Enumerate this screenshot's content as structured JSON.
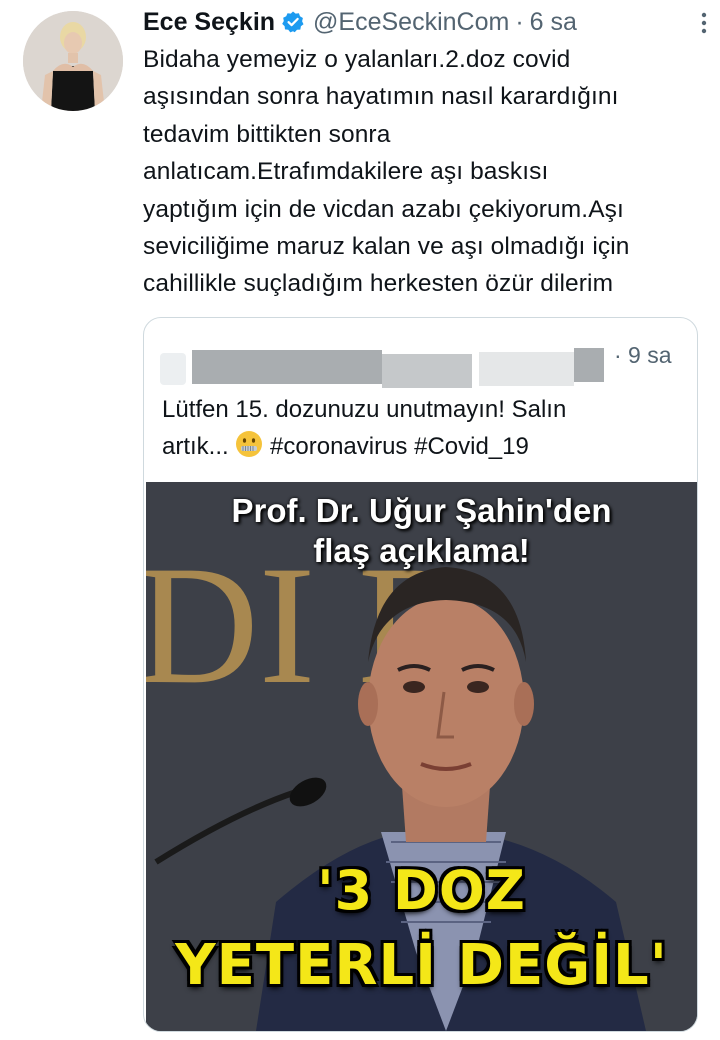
{
  "tweet": {
    "name": "Ece Seçkin",
    "handle": "@EceSeckinCom",
    "separator": "·",
    "time": "6 sa",
    "text": "Bidaha yemeyiz o yalanları.2.doz covid\naşısından sonra hayatımın nasıl karardığını\ntedavim bittikten sonra\nanlatıcam.Etrafımdakilere aşı baskısı\nyaptığım için de vicdan azabı çekiyorum.Aşı\nseviciliğime maruz kalan ve aşı olmadığı için\ncahillikle suçladığım herkesten özür dilerim",
    "icons": {
      "verified": "verified-badge-icon",
      "more": "more-options-icon",
      "avatar": "profile-avatar"
    },
    "colors": {
      "verified": "#1d9bf0",
      "secondary_text": "#536471",
      "border": "#cfd9de"
    }
  },
  "quote": {
    "time": "· 9 sa",
    "text_line1": "Lütfen 15. dozunuzu unutmayın! Salın",
    "text_line2_start": "artık... ",
    "emoji": "zipper-mouth-face",
    "hashtags": "#coronavirus #Covid_19",
    "image": {
      "headline_line1": "Prof. Dr. Uğur Şahin'den",
      "headline_line2": "flaş açıklama!",
      "quote_line1": "'3 DOZ",
      "quote_line2": "YETERLİ DEĞİL'",
      "background_letters": "DI D",
      "colors": {
        "headline": "#ffffff",
        "quote": "#f4e718",
        "background": "#3a3d44",
        "bg_letters": "#a88850"
      }
    }
  }
}
